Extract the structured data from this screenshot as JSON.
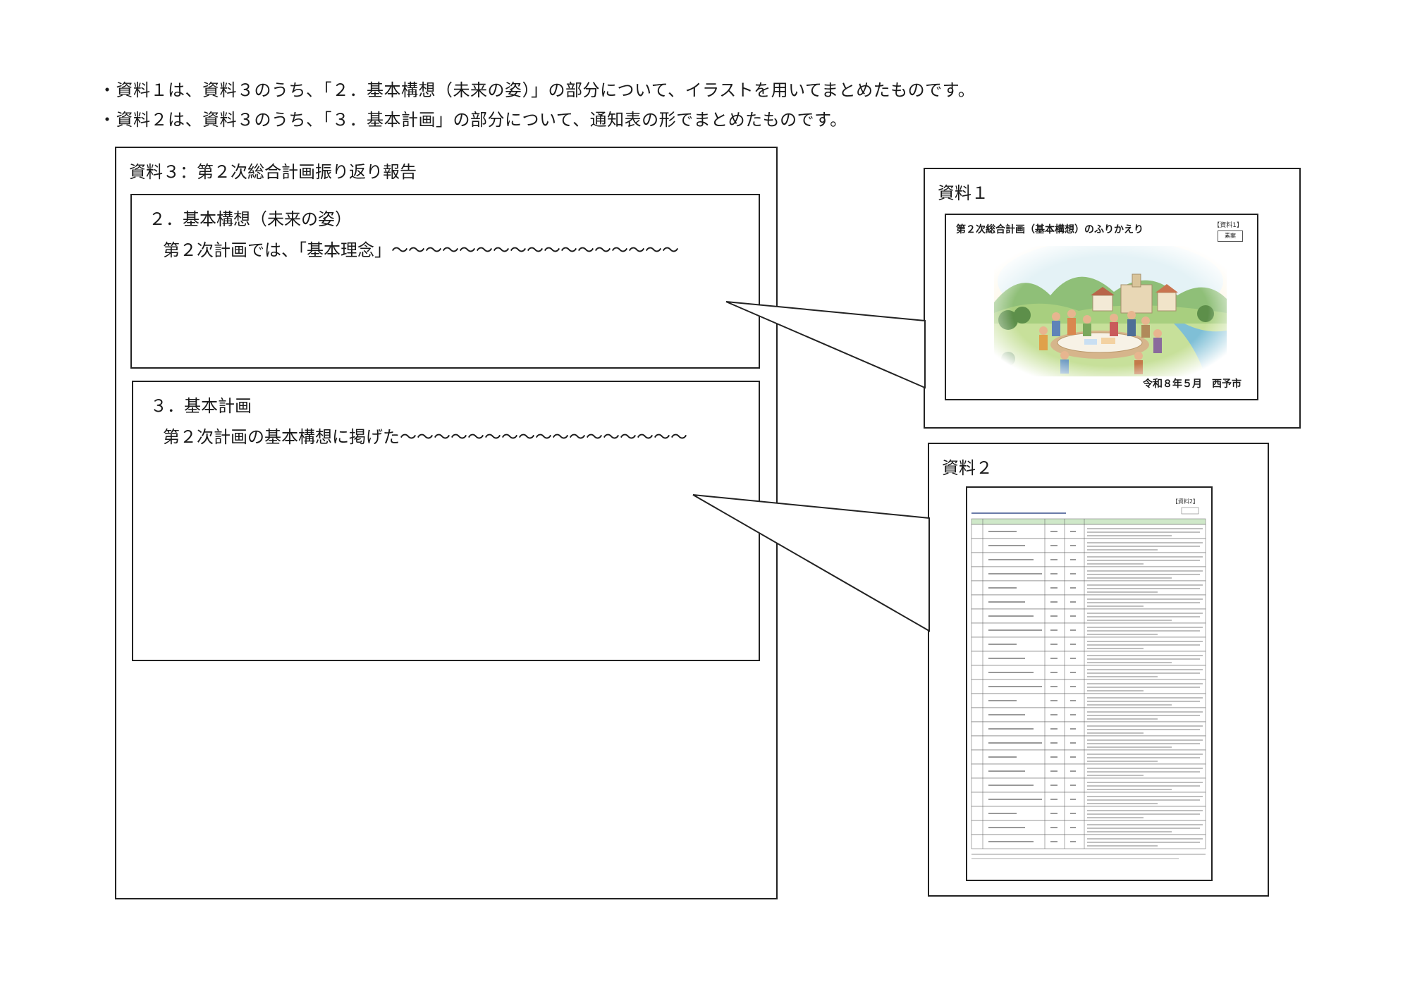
{
  "notes": [
    "・資料１は、資料３のうち、「２．基本構想（未来の姿）」の部分について、イラストを用いてまとめたものです。",
    "・資料２は、資料３のうち、「３．基本計画」の部分について、通知表の形でまとめたものです。"
  ],
  "doc3": {
    "title": "資料３：第２次総合計画振り返り報告",
    "section2": {
      "heading": "２．基本構想（未来の姿）",
      "text": "第２次計画では、「基本理念」〜〜〜〜〜〜〜〜〜〜〜〜〜〜〜〜〜"
    },
    "section3": {
      "heading": "３．基本計画",
      "text": "第２次計画の基本構想に掲げた〜〜〜〜〜〜〜〜〜〜〜〜〜〜〜〜〜"
    }
  },
  "doc1": {
    "label": "資料１",
    "thumb_title": "第２次総合計画（基本構想）のふりかえり",
    "thumb_tag": "【資料1】",
    "thumb_badge": "素案",
    "thumb_footer": "令和８年５月　西予市"
  },
  "doc2": {
    "label": "資料２",
    "thumb_tag": "【資料2】"
  },
  "colors": {
    "border": "#222222",
    "table_header": "#cfe8c9",
    "sky": "#dff1f7",
    "grass": "#b9d98a"
  }
}
